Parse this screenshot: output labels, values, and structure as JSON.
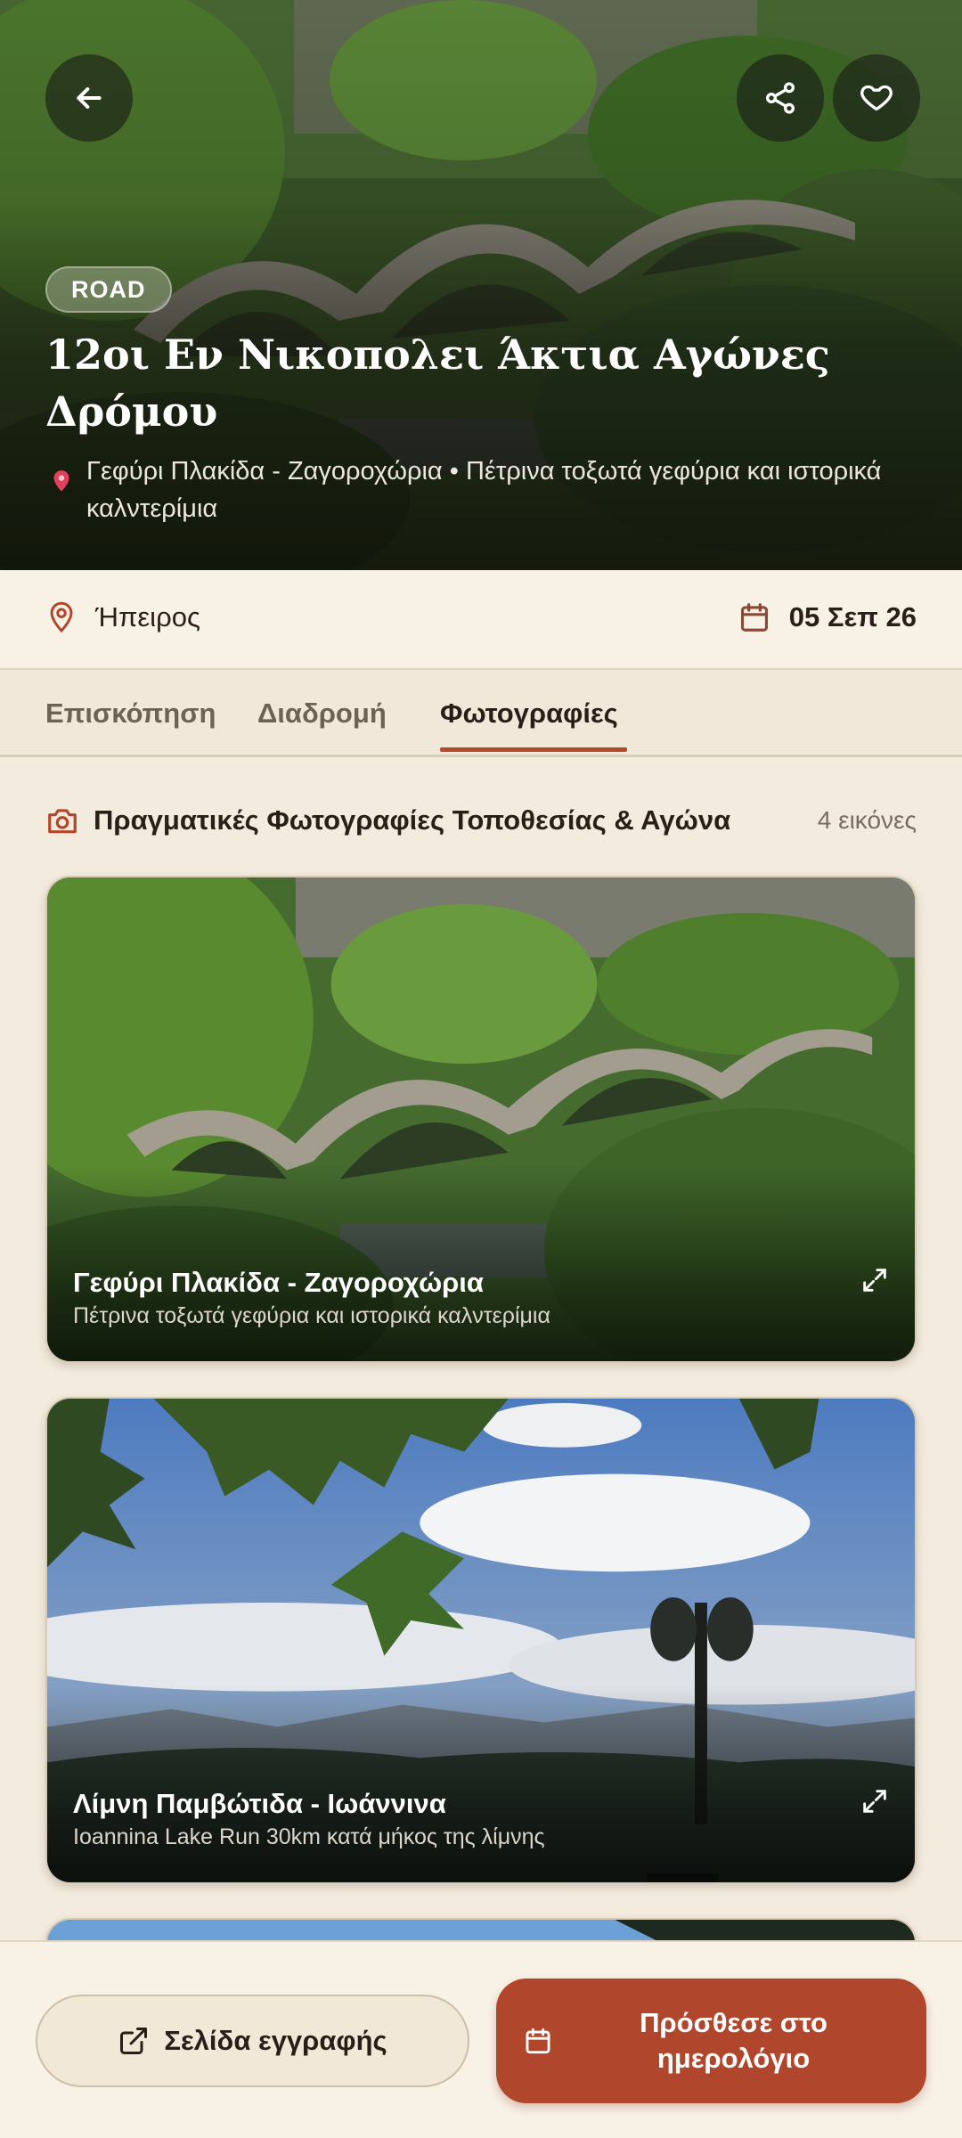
{
  "hero": {
    "badge": "ROAD",
    "title": "12οι Εν Νικοπολει Άκτια Αγώνες Δρόμου",
    "subtitle": "Γεφύρι Πλακίδα - Ζαγοροχώρια • Πέτρινα τοξωτά γεφύρια και ιστορικά καλντερίμια",
    "icons": {
      "back": "arrow-left-icon",
      "share": "share-icon",
      "favorite": "heart-icon",
      "pin": "map-pin-icon"
    }
  },
  "info": {
    "region": "Ήπειρος",
    "date": "05 Σεπ 26",
    "icons": {
      "region": "location-pin-icon",
      "date": "calendar-icon"
    }
  },
  "tabs": [
    {
      "label": "Επισκόπηση",
      "active": false
    },
    {
      "label": "Διαδρομή",
      "active": false
    },
    {
      "label": "Φωτογραφίες",
      "active": true
    }
  ],
  "photos": {
    "title": "Πραγματικές Φωτογραφίες Τοποθεσίας & Αγώνα",
    "count": "4 εικόνες",
    "items": [
      {
        "title": "Γεφύρι Πλακίδα - Ζαγοροχώρια",
        "caption": "Πέτρινα τοξωτά γεφύρια και ιστορικά καλντερίμια"
      },
      {
        "title": "Λίμνη Παμβώτιδα - Ιωάννινα",
        "caption": "Ioannina Lake Run 30km κατά μήκος της λίμνης"
      }
    ]
  },
  "actions": {
    "register": "Σελίδα εγγραφής",
    "add_calendar": "Πρόσθεσε στο ημερολόγιο"
  },
  "colors": {
    "accent": "#b0472c",
    "background": "#f3ebdd",
    "surface": "#f8f1e6"
  }
}
